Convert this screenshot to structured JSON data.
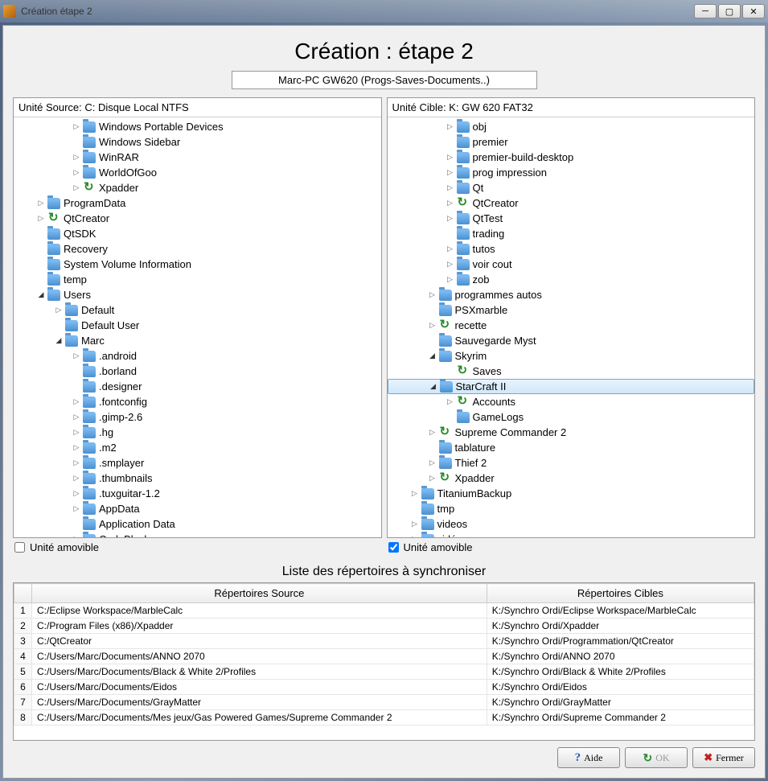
{
  "window": {
    "title": "Création étape 2"
  },
  "header": {
    "title": "Création : étape 2",
    "subtitle": "Marc-PC GW620 (Progs-Saves-Documents..)"
  },
  "source_pane": {
    "header": "Unité Source: C: Disque Local NTFS",
    "removable_label": "Unité amovible",
    "removable_checked": false,
    "tree": [
      {
        "indent": 3,
        "expander": "closed",
        "icon": "folder",
        "label": "Windows Portable Devices"
      },
      {
        "indent": 3,
        "expander": "none",
        "icon": "folder",
        "label": "Windows Sidebar"
      },
      {
        "indent": 3,
        "expander": "closed",
        "icon": "folder",
        "label": "WinRAR"
      },
      {
        "indent": 3,
        "expander": "closed",
        "icon": "folder",
        "label": "WorldOfGoo"
      },
      {
        "indent": 3,
        "expander": "closed",
        "icon": "sync",
        "label": "Xpadder"
      },
      {
        "indent": 1,
        "expander": "closed",
        "icon": "folder",
        "label": "ProgramData"
      },
      {
        "indent": 1,
        "expander": "closed",
        "icon": "sync",
        "label": "QtCreator"
      },
      {
        "indent": 1,
        "expander": "none",
        "icon": "folder",
        "label": "QtSDK"
      },
      {
        "indent": 1,
        "expander": "none",
        "icon": "folder",
        "label": "Recovery"
      },
      {
        "indent": 1,
        "expander": "none",
        "icon": "folder",
        "label": "System Volume Information"
      },
      {
        "indent": 1,
        "expander": "none",
        "icon": "folder",
        "label": "temp"
      },
      {
        "indent": 1,
        "expander": "open",
        "icon": "folder",
        "label": "Users"
      },
      {
        "indent": 2,
        "expander": "closed",
        "icon": "folder",
        "label": "Default"
      },
      {
        "indent": 2,
        "expander": "none",
        "icon": "folder",
        "label": "Default User"
      },
      {
        "indent": 2,
        "expander": "open",
        "icon": "folder",
        "label": "Marc"
      },
      {
        "indent": 3,
        "expander": "closed",
        "icon": "folder",
        "label": ".android"
      },
      {
        "indent": 3,
        "expander": "none",
        "icon": "folder",
        "label": ".borland"
      },
      {
        "indent": 3,
        "expander": "none",
        "icon": "folder",
        "label": ".designer"
      },
      {
        "indent": 3,
        "expander": "closed",
        "icon": "folder",
        "label": ".fontconfig"
      },
      {
        "indent": 3,
        "expander": "closed",
        "icon": "folder",
        "label": ".gimp-2.6"
      },
      {
        "indent": 3,
        "expander": "closed",
        "icon": "folder",
        "label": ".hg"
      },
      {
        "indent": 3,
        "expander": "closed",
        "icon": "folder",
        "label": ".m2"
      },
      {
        "indent": 3,
        "expander": "closed",
        "icon": "folder",
        "label": ".smplayer"
      },
      {
        "indent": 3,
        "expander": "closed",
        "icon": "folder",
        "label": ".thumbnails"
      },
      {
        "indent": 3,
        "expander": "closed",
        "icon": "folder",
        "label": ".tuxguitar-1.2"
      },
      {
        "indent": 3,
        "expander": "closed",
        "icon": "folder",
        "label": "AppData"
      },
      {
        "indent": 3,
        "expander": "none",
        "icon": "folder",
        "label": "Application Data"
      },
      {
        "indent": 3,
        "expander": "closed",
        "icon": "folder",
        "label": "CodeBlocks"
      }
    ]
  },
  "target_pane": {
    "header": "Unité Cible: K: GW 620 FAT32",
    "removable_label": "Unité amovible",
    "removable_checked": true,
    "tree": [
      {
        "indent": 3,
        "expander": "closed",
        "icon": "folder",
        "label": "obj"
      },
      {
        "indent": 3,
        "expander": "none",
        "icon": "folder",
        "label": "premier"
      },
      {
        "indent": 3,
        "expander": "closed",
        "icon": "folder",
        "label": "premier-build-desktop"
      },
      {
        "indent": 3,
        "expander": "closed",
        "icon": "folder",
        "label": "prog impression"
      },
      {
        "indent": 3,
        "expander": "closed",
        "icon": "folder",
        "label": "Qt"
      },
      {
        "indent": 3,
        "expander": "closed",
        "icon": "sync",
        "label": "QtCreator"
      },
      {
        "indent": 3,
        "expander": "closed",
        "icon": "folder",
        "label": "QtTest"
      },
      {
        "indent": 3,
        "expander": "none",
        "icon": "folder",
        "label": "trading"
      },
      {
        "indent": 3,
        "expander": "closed",
        "icon": "folder",
        "label": "tutos"
      },
      {
        "indent": 3,
        "expander": "closed",
        "icon": "folder",
        "label": "voir cout"
      },
      {
        "indent": 3,
        "expander": "closed",
        "icon": "folder",
        "label": "zob"
      },
      {
        "indent": 2,
        "expander": "closed",
        "icon": "folder",
        "label": "programmes autos"
      },
      {
        "indent": 2,
        "expander": "none",
        "icon": "folder",
        "label": "PSXmarble"
      },
      {
        "indent": 2,
        "expander": "closed",
        "icon": "sync",
        "label": "recette"
      },
      {
        "indent": 2,
        "expander": "none",
        "icon": "folder",
        "label": "Sauvegarde Myst"
      },
      {
        "indent": 2,
        "expander": "open",
        "icon": "folder",
        "label": "Skyrim"
      },
      {
        "indent": 3,
        "expander": "none",
        "icon": "sync",
        "label": "Saves"
      },
      {
        "indent": 2,
        "expander": "open",
        "icon": "folder",
        "label": "StarCraft II",
        "selected": true
      },
      {
        "indent": 3,
        "expander": "closed",
        "icon": "sync",
        "label": "Accounts"
      },
      {
        "indent": 3,
        "expander": "none",
        "icon": "folder",
        "label": "GameLogs"
      },
      {
        "indent": 2,
        "expander": "closed",
        "icon": "sync",
        "label": "Supreme Commander 2"
      },
      {
        "indent": 2,
        "expander": "none",
        "icon": "folder",
        "label": "tablature"
      },
      {
        "indent": 2,
        "expander": "closed",
        "icon": "folder",
        "label": "Thief 2"
      },
      {
        "indent": 2,
        "expander": "closed",
        "icon": "sync",
        "label": "Xpadder"
      },
      {
        "indent": 1,
        "expander": "closed",
        "icon": "folder",
        "label": "TitaniumBackup"
      },
      {
        "indent": 1,
        "expander": "none",
        "icon": "folder",
        "label": "tmp"
      },
      {
        "indent": 1,
        "expander": "closed",
        "icon": "folder",
        "label": "videos"
      },
      {
        "indent": 1,
        "expander": "closed",
        "icon": "folder",
        "label": "vidéo"
      }
    ]
  },
  "sync_list": {
    "title": "Liste des répertoires à synchroniser",
    "col_source": "Répertoires Source",
    "col_target": "Répertoires Cibles",
    "rows": [
      {
        "n": "1",
        "src": "C:/Eclipse Workspace/MarbleCalc",
        "dst": "K:/Synchro Ordi/Eclipse Workspace/MarbleCalc"
      },
      {
        "n": "2",
        "src": "C:/Program Files (x86)/Xpadder",
        "dst": "K:/Synchro Ordi/Xpadder"
      },
      {
        "n": "3",
        "src": "C:/QtCreator",
        "dst": "K:/Synchro Ordi/Programmation/QtCreator"
      },
      {
        "n": "4",
        "src": "C:/Users/Marc/Documents/ANNO 2070",
        "dst": "K:/Synchro Ordi/ANNO 2070"
      },
      {
        "n": "5",
        "src": "C:/Users/Marc/Documents/Black & White 2/Profiles",
        "dst": "K:/Synchro Ordi/Black & White 2/Profiles"
      },
      {
        "n": "6",
        "src": "C:/Users/Marc/Documents/Eidos",
        "dst": "K:/Synchro Ordi/Eidos"
      },
      {
        "n": "7",
        "src": "C:/Users/Marc/Documents/GrayMatter",
        "dst": "K:/Synchro Ordi/GrayMatter"
      },
      {
        "n": "8",
        "src": "C:/Users/Marc/Documents/Mes jeux/Gas Powered Games/Supreme Commander 2",
        "dst": "K:/Synchro Ordi/Supreme Commander 2"
      }
    ]
  },
  "buttons": {
    "help": "Aide",
    "ok": "OK",
    "close": "Fermer"
  }
}
